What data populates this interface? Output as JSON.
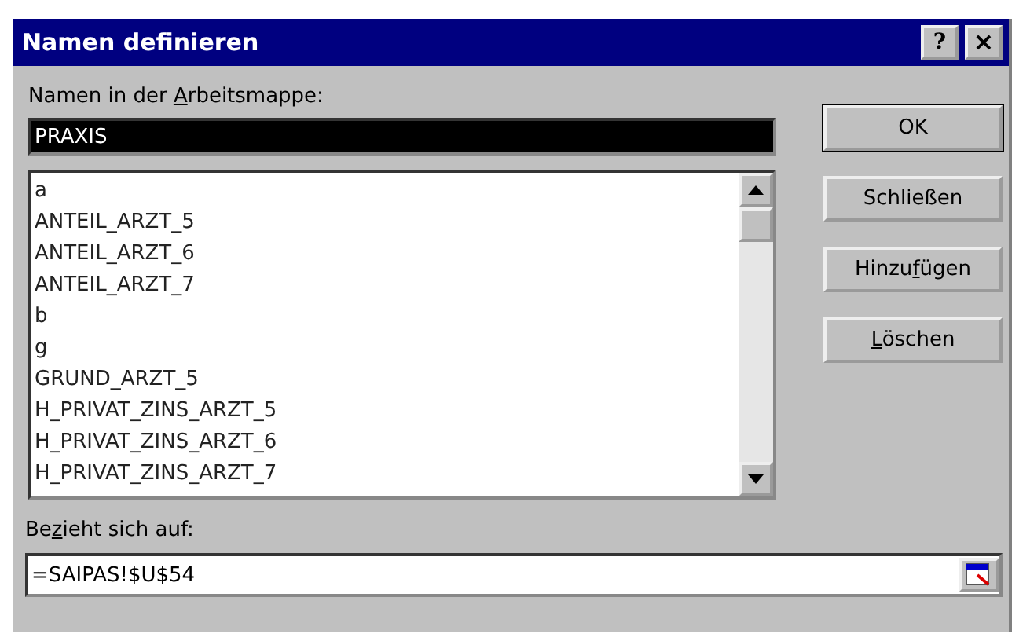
{
  "window": {
    "title": "Namen definieren"
  },
  "title_buttons": [
    {
      "kind": "help",
      "label": "?"
    },
    {
      "kind": "close",
      "label": "×"
    }
  ],
  "names_label": {
    "before": "Namen in der ",
    "key": "A",
    "after": "rbeitsmappe:"
  },
  "name_field": {
    "value": "PRAXIS",
    "selected": true
  },
  "names_list": [
    {
      "label": "a"
    },
    {
      "label": "ANTEIL_ARZT_5"
    },
    {
      "label": "ANTEIL_ARZT_6"
    },
    {
      "label": "ANTEIL_ARZT_7"
    },
    {
      "label": "b"
    },
    {
      "label": "g"
    },
    {
      "label": "GRUND_ARZT_5"
    },
    {
      "label": "H_PRIVAT_ZINS_ARZT_5"
    },
    {
      "label": "H_PRIVAT_ZINS_ARZT_6"
    },
    {
      "label": "H_PRIVAT_ZINS_ARZT_7"
    }
  ],
  "buttons": [
    {
      "before": "OK",
      "default": true
    },
    {
      "before": "Schließen",
      "default": false
    },
    {
      "before": "Hinzu",
      "key": "f",
      "after": "ügen",
      "default": false
    },
    {
      "key": "L",
      "after": "öschen",
      "default": false
    }
  ],
  "refers_label": {
    "before": "Be",
    "key": "z",
    "after": "ieht sich auf:"
  },
  "refers_field": {
    "value": "=SAIPAS!$U$54"
  }
}
